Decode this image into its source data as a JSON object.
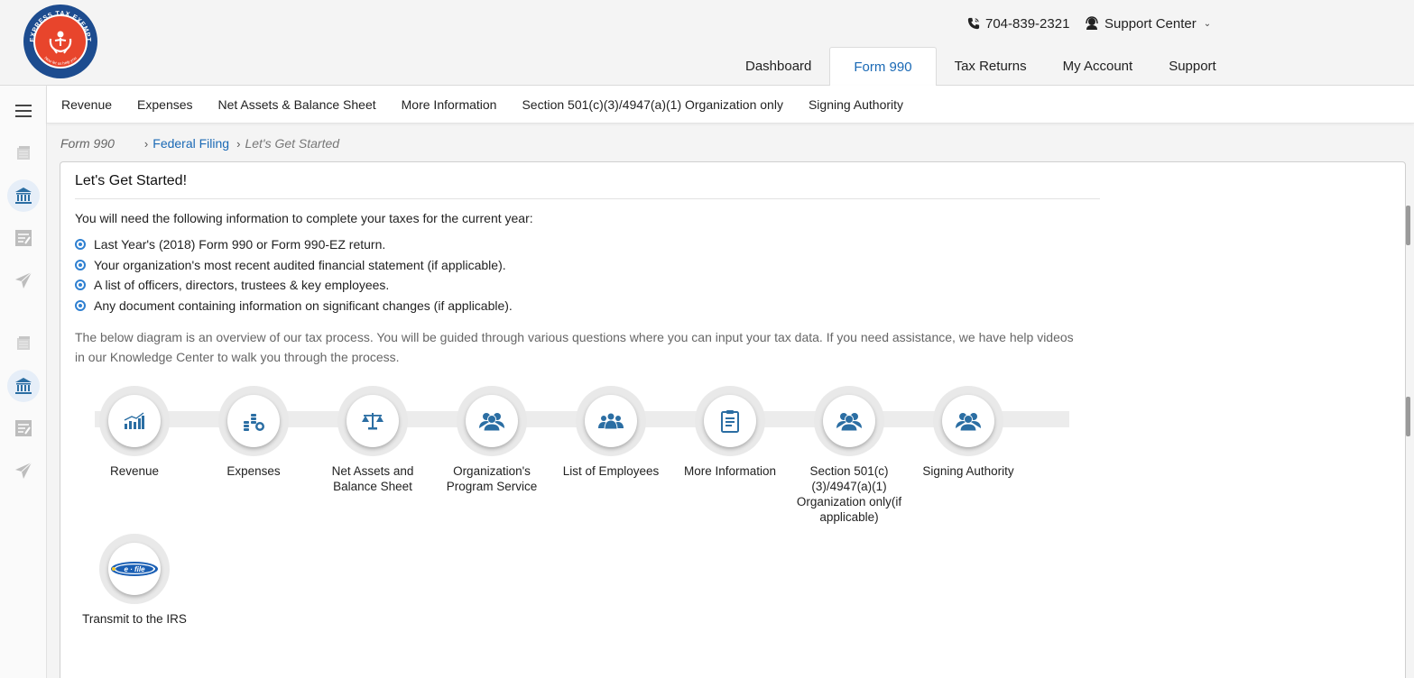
{
  "header": {
    "logo_text": "EXPRESS TAX EXEMPT",
    "logo_tagline": "Now let us help you",
    "phone": "704-839-2321",
    "support_center": "Support Center",
    "nav": [
      {
        "label": "Dashboard",
        "active": false
      },
      {
        "label": "Form 990",
        "active": true
      },
      {
        "label": "Tax Returns",
        "active": false
      },
      {
        "label": "My Account",
        "active": false
      },
      {
        "label": "Support",
        "active": false
      }
    ]
  },
  "subnav": [
    "Revenue",
    "Expenses",
    "Net Assets & Balance Sheet",
    "More Information",
    "Section 501(c)(3)/4947(a)(1) Organization only",
    "Signing Authority"
  ],
  "breadcrumb": {
    "form": "Form 990",
    "link": "Federal Filing",
    "current": "Let's Get Started"
  },
  "panel": {
    "title": "Let's Get Started!",
    "intro": "You will need the following information to complete your taxes for the current year:",
    "requirements": [
      "Last Year's (2018) Form 990 or Form 990-EZ return.",
      "Your organization's most recent audited financial statement (if applicable).",
      "A list of officers, directors, trustees & key employees.",
      "Any document containing information on significant changes (if applicable)."
    ],
    "overview": "The below diagram is an overview of our tax process. You will be guided through various questions where you can input your tax data. If you need assistance, we have help videos in our Knowledge Center to walk you through the process."
  },
  "steps": [
    {
      "label": "Revenue",
      "icon": "revenue-chart-icon"
    },
    {
      "label": "Expenses",
      "icon": "coins-icon"
    },
    {
      "label": "Net Assets and Balance Sheet",
      "icon": "balance-scale-icon"
    },
    {
      "label": "Organization's Program Service",
      "icon": "group-icon"
    },
    {
      "label": "List of Employees",
      "icon": "employees-icon"
    },
    {
      "label": "More Information",
      "icon": "document-icon"
    },
    {
      "label": "Section 501(c)(3)/4947(a)(1) Organization only(if applicable)",
      "icon": "group-icon"
    },
    {
      "label": "Signing Authority",
      "icon": "group-icon"
    },
    {
      "label": "Transmit to the IRS",
      "icon": "efile-icon"
    }
  ],
  "colors": {
    "accent": "#1a69b5",
    "icon_blue": "#2b6ea3",
    "logo_orange": "#e8452c",
    "logo_navy": "#1d4c8f"
  }
}
